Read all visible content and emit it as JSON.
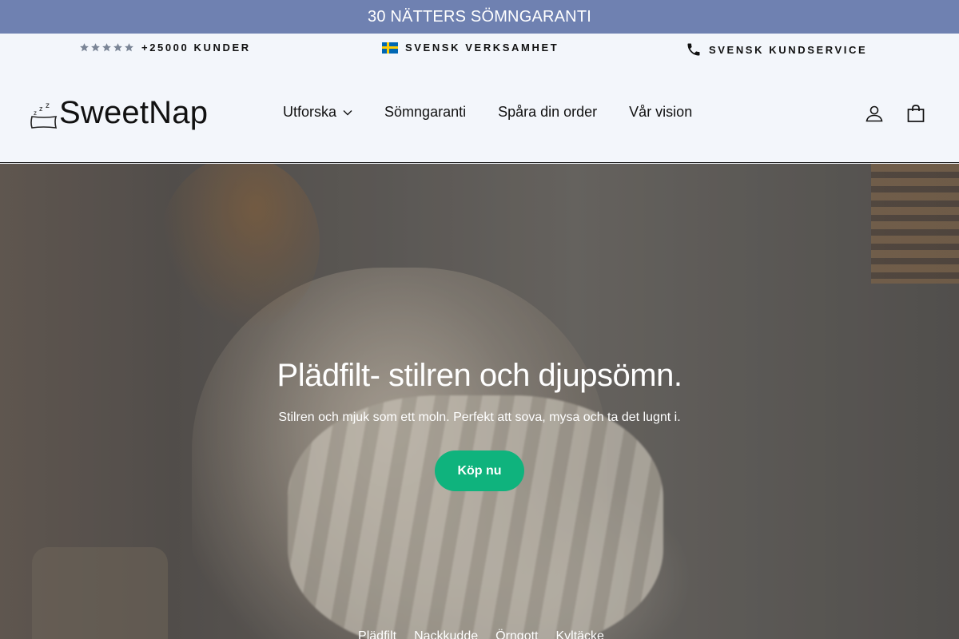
{
  "announcement": {
    "text": "30 NÄTTERS SÖMNGARANTI",
    "background": "#6f81b1"
  },
  "trust_bar": {
    "items": [
      {
        "icon": "five-stars-icon",
        "label": "+25000 KUNDER"
      },
      {
        "icon": "swedish-flag-icon",
        "label": "SVENSK VERKSAMHET"
      },
      {
        "icon": "phone-icon",
        "label": "SVENSK KUNDSERVICE"
      }
    ]
  },
  "header": {
    "logo": {
      "text": "SweetNap",
      "icon": "sleeping-pillow-zzz-icon"
    },
    "nav": [
      {
        "label": "Utforska",
        "has_dropdown": true
      },
      {
        "label": "Sömngaranti"
      },
      {
        "label": "Spåra din order"
      },
      {
        "label": "Vår vision"
      }
    ],
    "icons": [
      "account-icon",
      "cart-icon"
    ]
  },
  "hero": {
    "title": "Plädfilt- stilren och djupsömn.",
    "subtitle": "Stilren och mjuk som ett moln. Perfekt att sova, mysa och ta det lugnt i.",
    "button_label": "Köp nu",
    "button_color": "#0fb37d",
    "category_links": [
      "Plädfilt",
      "Nackkudde",
      "Örngott",
      "Kyltäcke"
    ]
  }
}
